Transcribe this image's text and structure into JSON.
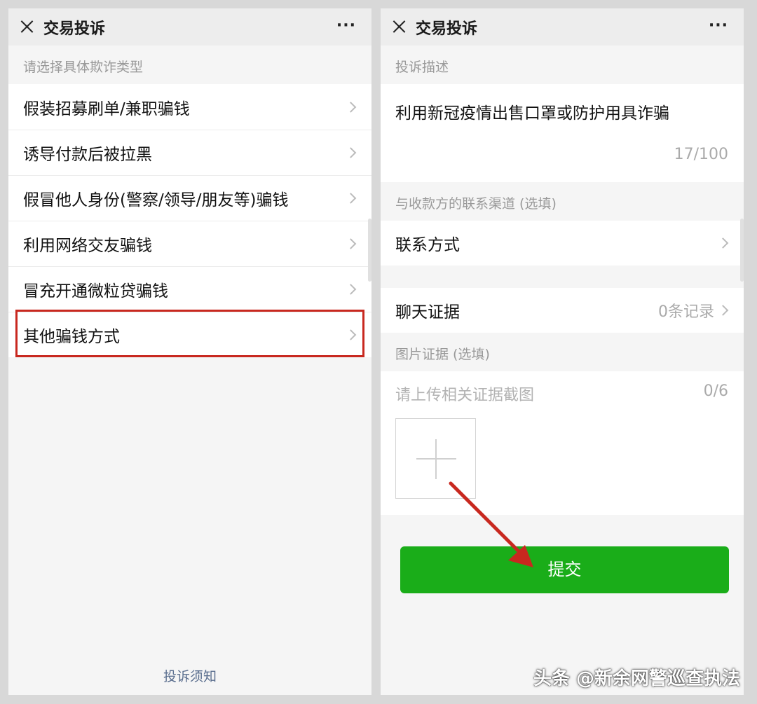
{
  "left": {
    "title": "交易投诉",
    "more": "···",
    "section_label": "请选择具体欺诈类型",
    "items": [
      {
        "label": "假装招募刷单/兼职骗钱"
      },
      {
        "label": "诱导付款后被拉黑"
      },
      {
        "label": "假冒他人身份(警察/领导/朋友等)骗钱"
      },
      {
        "label": "利用网络交友骗钱"
      },
      {
        "label": "冒充开通微粒贷骗钱"
      },
      {
        "label": "其他骗钱方式"
      }
    ],
    "footer_link": "投诉须知"
  },
  "right": {
    "title": "交易投诉",
    "more": "···",
    "desc_label": "投诉描述",
    "desc_text": "利用新冠疫情出售口罩或防护用具诈骗",
    "desc_count": "17/100",
    "contact_label": "与收款方的联系渠道 (选填)",
    "contact_row": "联系方式",
    "chat_row": "聊天证据",
    "chat_value": "0条记录",
    "image_label": "图片证据 (选填)",
    "upload_placeholder": "请上传相关证据截图",
    "upload_count": "0/6",
    "submit_label": "提交"
  },
  "watermark": "头条 @新余网警巡查执法",
  "colors": {
    "highlight": "#c8281f",
    "submit": "#1aad19",
    "arrow": "#c8281f"
  }
}
